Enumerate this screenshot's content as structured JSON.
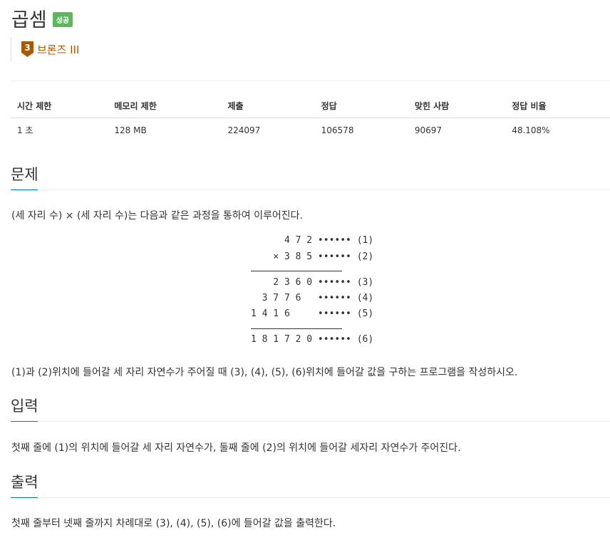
{
  "header": {
    "title": "곱셈",
    "badge": "성공",
    "tier": "브론즈 III",
    "tier_number": "3",
    "tier_color": "#ad5600"
  },
  "stats": {
    "headers": [
      "시간 제한",
      "메모리 제한",
      "제출",
      "정답",
      "맞힌 사람",
      "정답 비율"
    ],
    "values": [
      "1 초",
      "128 MB",
      "224097",
      "106578",
      "90697",
      "48.108%"
    ]
  },
  "problem": {
    "heading": "문제",
    "intro": "(세 자리 수) × (세 자리 수)는 다음과 같은 과정을 통하여 이루어진다.",
    "calc": [
      "      4 7 2 •••••• (1)",
      "    × 3 8 5 •••••• (2)",
      "    2 3 6 0 •••••• (3)",
      "  3 7 7 6   •••••• (4)",
      "1 4 1 6     •••••• (5)",
      "1 8 1 7 2 0 •••••• (6)"
    ],
    "question": "(1)과 (2)위치에 들어갈 세 자리 자연수가 주어질 때 (3), (4), (5), (6)위치에 들어갈 값을 구하는 프로그램을 작성하시오."
  },
  "input": {
    "heading": "입력",
    "text": "첫째 줄에 (1)의 위치에 들어갈 세 자리 자연수가, 둘째 줄에 (2)의 위치에 들어갈 세자리 자연수가 주어진다."
  },
  "output": {
    "heading": "출력",
    "text": "첫째 줄부터 넷째 줄까지 차례대로 (3), (4), (5), (6)에 들어갈 값을 출력한다."
  },
  "colors": {
    "accent": "#0076c0",
    "badge": "#5cb85c",
    "tier": "#ad5600"
  }
}
